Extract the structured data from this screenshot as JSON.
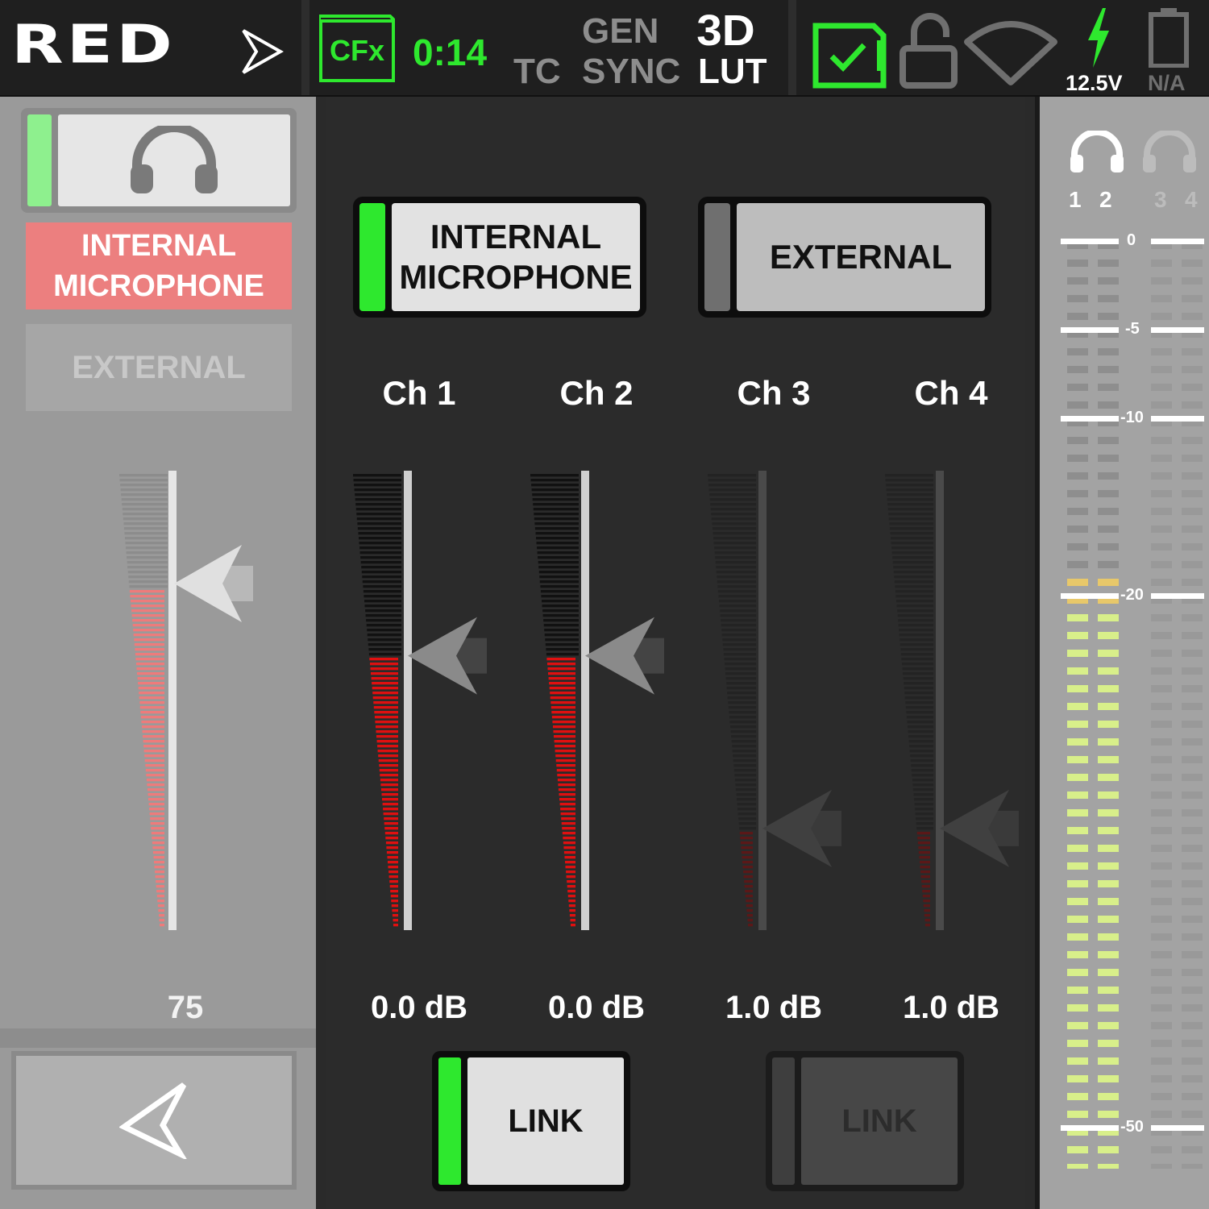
{
  "status_bar": {
    "brand": "RED",
    "media": "CFx",
    "record_time": "0:14",
    "tc": "TC",
    "gen": "GEN",
    "sync": "SYNC",
    "lut_3d": "3D",
    "lut_text": "LUT",
    "voltage": "12.5V",
    "battery_status": "N/A",
    "icons": [
      "play-arrow-icon",
      "media-check-icon",
      "unlock-icon",
      "wifi-icon",
      "power-bolt-icon",
      "battery-icon"
    ],
    "accent_color": "#2ee82e"
  },
  "left_panel": {
    "headphone_icon": "headphones-icon",
    "internal_label": "INTERNAL MICROPHONE",
    "internal_line1": "INTERNAL",
    "internal_line2": "MICROPHONE",
    "external_label": "EXTERNAL",
    "headphone_volume": "75",
    "volume_level": 0.75,
    "back_icon": "back-arrow-icon"
  },
  "source_buttons": [
    {
      "line1": "INTERNAL",
      "line2": "MICROPHONE",
      "active": true
    },
    {
      "line1": "EXTERNAL",
      "line2": "",
      "active": false
    }
  ],
  "channels": [
    {
      "label": "Ch 1",
      "gain": "0.0 dB",
      "active": true,
      "fader_level": 0.6
    },
    {
      "label": "Ch 2",
      "gain": "0.0 dB",
      "active": true,
      "fader_level": 0.6
    },
    {
      "label": "Ch 3",
      "gain": "1.0 dB",
      "active": false,
      "fader_level": 0.22
    },
    {
      "label": "Ch 4",
      "gain": "1.0 dB",
      "active": false,
      "fader_level": 0.22
    }
  ],
  "link_buttons": [
    {
      "label": "LINK",
      "active": true
    },
    {
      "label": "LINK",
      "active": false
    }
  ],
  "meters": {
    "monitor_channels": [
      "1",
      "2",
      "3",
      "4"
    ],
    "scale_labels": [
      "0",
      "-5",
      "-10",
      "-20",
      "-50"
    ],
    "meter_levels": [
      -20,
      -20,
      null,
      null
    ],
    "level_color": "#d8ef8a",
    "peak_color": "#e8c86a"
  }
}
